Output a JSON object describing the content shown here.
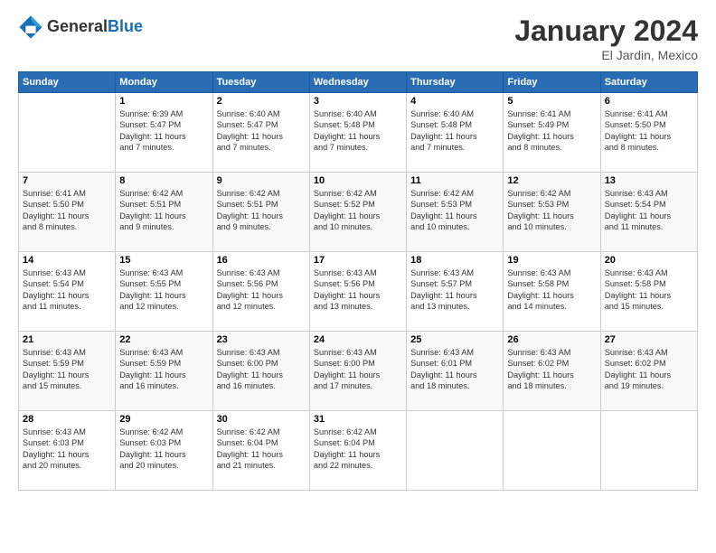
{
  "header": {
    "logo_general": "General",
    "logo_blue": "Blue",
    "month_title": "January 2024",
    "location": "El Jardin, Mexico"
  },
  "days_of_week": [
    "Sunday",
    "Monday",
    "Tuesday",
    "Wednesday",
    "Thursday",
    "Friday",
    "Saturday"
  ],
  "weeks": [
    [
      {
        "day": "",
        "info": ""
      },
      {
        "day": "1",
        "info": "Sunrise: 6:39 AM\nSunset: 5:47 PM\nDaylight: 11 hours\nand 7 minutes."
      },
      {
        "day": "2",
        "info": "Sunrise: 6:40 AM\nSunset: 5:47 PM\nDaylight: 11 hours\nand 7 minutes."
      },
      {
        "day": "3",
        "info": "Sunrise: 6:40 AM\nSunset: 5:48 PM\nDaylight: 11 hours\nand 7 minutes."
      },
      {
        "day": "4",
        "info": "Sunrise: 6:40 AM\nSunset: 5:48 PM\nDaylight: 11 hours\nand 7 minutes."
      },
      {
        "day": "5",
        "info": "Sunrise: 6:41 AM\nSunset: 5:49 PM\nDaylight: 11 hours\nand 8 minutes."
      },
      {
        "day": "6",
        "info": "Sunrise: 6:41 AM\nSunset: 5:50 PM\nDaylight: 11 hours\nand 8 minutes."
      }
    ],
    [
      {
        "day": "7",
        "info": "Sunrise: 6:41 AM\nSunset: 5:50 PM\nDaylight: 11 hours\nand 8 minutes."
      },
      {
        "day": "8",
        "info": "Sunrise: 6:42 AM\nSunset: 5:51 PM\nDaylight: 11 hours\nand 9 minutes."
      },
      {
        "day": "9",
        "info": "Sunrise: 6:42 AM\nSunset: 5:51 PM\nDaylight: 11 hours\nand 9 minutes."
      },
      {
        "day": "10",
        "info": "Sunrise: 6:42 AM\nSunset: 5:52 PM\nDaylight: 11 hours\nand 10 minutes."
      },
      {
        "day": "11",
        "info": "Sunrise: 6:42 AM\nSunset: 5:53 PM\nDaylight: 11 hours\nand 10 minutes."
      },
      {
        "day": "12",
        "info": "Sunrise: 6:42 AM\nSunset: 5:53 PM\nDaylight: 11 hours\nand 10 minutes."
      },
      {
        "day": "13",
        "info": "Sunrise: 6:43 AM\nSunset: 5:54 PM\nDaylight: 11 hours\nand 11 minutes."
      }
    ],
    [
      {
        "day": "14",
        "info": "Sunrise: 6:43 AM\nSunset: 5:54 PM\nDaylight: 11 hours\nand 11 minutes."
      },
      {
        "day": "15",
        "info": "Sunrise: 6:43 AM\nSunset: 5:55 PM\nDaylight: 11 hours\nand 12 minutes."
      },
      {
        "day": "16",
        "info": "Sunrise: 6:43 AM\nSunset: 5:56 PM\nDaylight: 11 hours\nand 12 minutes."
      },
      {
        "day": "17",
        "info": "Sunrise: 6:43 AM\nSunset: 5:56 PM\nDaylight: 11 hours\nand 13 minutes."
      },
      {
        "day": "18",
        "info": "Sunrise: 6:43 AM\nSunset: 5:57 PM\nDaylight: 11 hours\nand 13 minutes."
      },
      {
        "day": "19",
        "info": "Sunrise: 6:43 AM\nSunset: 5:58 PM\nDaylight: 11 hours\nand 14 minutes."
      },
      {
        "day": "20",
        "info": "Sunrise: 6:43 AM\nSunset: 5:58 PM\nDaylight: 11 hours\nand 15 minutes."
      }
    ],
    [
      {
        "day": "21",
        "info": "Sunrise: 6:43 AM\nSunset: 5:59 PM\nDaylight: 11 hours\nand 15 minutes."
      },
      {
        "day": "22",
        "info": "Sunrise: 6:43 AM\nSunset: 5:59 PM\nDaylight: 11 hours\nand 16 minutes."
      },
      {
        "day": "23",
        "info": "Sunrise: 6:43 AM\nSunset: 6:00 PM\nDaylight: 11 hours\nand 16 minutes."
      },
      {
        "day": "24",
        "info": "Sunrise: 6:43 AM\nSunset: 6:00 PM\nDaylight: 11 hours\nand 17 minutes."
      },
      {
        "day": "25",
        "info": "Sunrise: 6:43 AM\nSunset: 6:01 PM\nDaylight: 11 hours\nand 18 minutes."
      },
      {
        "day": "26",
        "info": "Sunrise: 6:43 AM\nSunset: 6:02 PM\nDaylight: 11 hours\nand 18 minutes."
      },
      {
        "day": "27",
        "info": "Sunrise: 6:43 AM\nSunset: 6:02 PM\nDaylight: 11 hours\nand 19 minutes."
      }
    ],
    [
      {
        "day": "28",
        "info": "Sunrise: 6:43 AM\nSunset: 6:03 PM\nDaylight: 11 hours\nand 20 minutes."
      },
      {
        "day": "29",
        "info": "Sunrise: 6:42 AM\nSunset: 6:03 PM\nDaylight: 11 hours\nand 20 minutes."
      },
      {
        "day": "30",
        "info": "Sunrise: 6:42 AM\nSunset: 6:04 PM\nDaylight: 11 hours\nand 21 minutes."
      },
      {
        "day": "31",
        "info": "Sunrise: 6:42 AM\nSunset: 6:04 PM\nDaylight: 11 hours\nand 22 minutes."
      },
      {
        "day": "",
        "info": ""
      },
      {
        "day": "",
        "info": ""
      },
      {
        "day": "",
        "info": ""
      }
    ]
  ]
}
